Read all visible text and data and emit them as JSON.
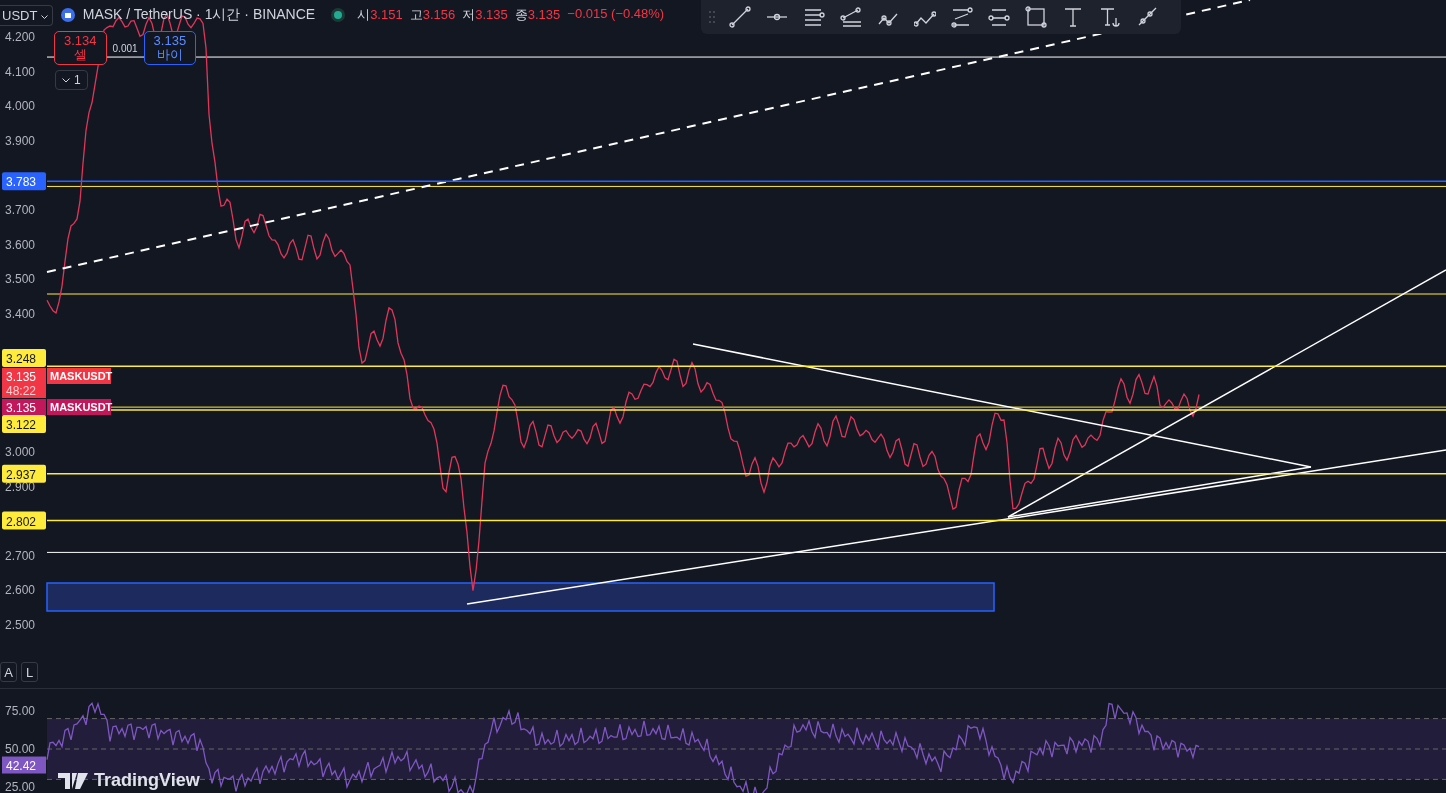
{
  "header": {
    "symbol_button": "USDT",
    "title": "MASK / TetherUS · 1시간 · BINANCE",
    "ohlc": [
      {
        "label": "시",
        "value": "3.151"
      },
      {
        "label": "고",
        "value": "3.156"
      },
      {
        "label": "저",
        "value": "3.135"
      },
      {
        "label": "종",
        "value": "3.135"
      }
    ],
    "change": "−0.015 (−0.48%)"
  },
  "trade_buttons": {
    "sell": {
      "price": "3.134",
      "label": "셀"
    },
    "spread": "0.001",
    "buy": {
      "price": "3.135",
      "label": "바이"
    }
  },
  "collapse_button": "1",
  "price_axis": {
    "ticks": [
      "4.200",
      "4.100",
      "4.000",
      "3.900",
      "3.700",
      "3.600",
      "3.500",
      "3.400",
      "3.000",
      "2.900",
      "2.700",
      "2.600",
      "2.500"
    ]
  },
  "price_lines": [
    {
      "label": "3.783",
      "color": "#2962ff"
    },
    {
      "label": "3.248",
      "color": "#ffeb3b"
    },
    {
      "label": "3.122",
      "color": "#ffeb3b"
    },
    {
      "label": "2.937",
      "color": "#ffeb3b"
    },
    {
      "label": "2.802",
      "color": "#ffeb3b"
    }
  ],
  "symbol_tags": [
    {
      "price": "3.135",
      "countdown": "48:22",
      "name": "MASKUSDT",
      "color": "#f23645"
    },
    {
      "price": "3.135",
      "name": "MASKUSDT",
      "color": "#c2185b"
    }
  ],
  "scale_buttons": [
    "A",
    "L"
  ],
  "rsi": {
    "ticks": [
      "75.00",
      "50.00",
      "25.00"
    ],
    "value": "42.42"
  },
  "logo": "TradingView"
}
